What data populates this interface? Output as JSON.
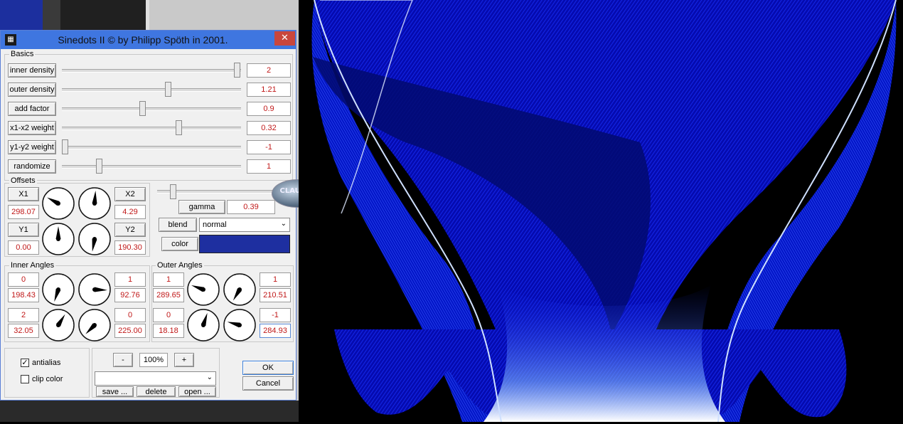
{
  "window": {
    "title": "Sinedots II © by Philipp Spöth in 2001.",
    "icon": "app-pattern-icon",
    "close_label": "✕"
  },
  "basics": {
    "label": "Basics",
    "rows": [
      {
        "label": "inner density",
        "value": "2",
        "slider": 1.0
      },
      {
        "label": "outer density",
        "value": "1.21",
        "slider": 0.6
      },
      {
        "label": "add factor",
        "value": "0.9",
        "slider": 0.45
      },
      {
        "label": "x1-x2 weight",
        "value": "0.32",
        "slider": 0.66
      },
      {
        "label": "y1-y2 weight",
        "value": "-1",
        "slider": 0.0
      },
      {
        "label": "randomize",
        "value": "1",
        "slider": 0.2
      }
    ]
  },
  "offsets": {
    "label": "Offsets",
    "x1": {
      "label": "X1",
      "value": "298.07"
    },
    "x2": {
      "label": "X2",
      "value": "4.29"
    },
    "y1": {
      "label": "Y1",
      "value": "0.00"
    },
    "y2": {
      "label": "Y2",
      "value": "190.30"
    }
  },
  "gamma": {
    "label": "gamma",
    "value": "0.39",
    "slider": 0.1
  },
  "blend": {
    "label": "blend",
    "value": "normal"
  },
  "color": {
    "label": "color",
    "swatch": "#1e2fa0"
  },
  "inner_angles": {
    "label": "Inner Angles",
    "a": {
      "top": "0",
      "value": "198.43"
    },
    "b": {
      "top": "1",
      "value": "92.76"
    },
    "c": {
      "top": "2",
      "value": "32.05"
    },
    "d": {
      "top": "0",
      "value": "225.00"
    }
  },
  "outer_angles": {
    "label": "Outer Angles",
    "a": {
      "top": "1",
      "value": "289.65"
    },
    "b": {
      "top": "1",
      "value": "210.51"
    },
    "c": {
      "top": "0",
      "value": "18.18"
    },
    "d": {
      "top": "-1",
      "value": "284.93"
    }
  },
  "options": {
    "antialias": {
      "label": "antialias",
      "checked": true
    },
    "clip_color": {
      "label": "clip color",
      "checked": false
    }
  },
  "zoom": {
    "minus": "-",
    "value": "100%",
    "plus": "+"
  },
  "presets": {
    "save": "save ...",
    "delete": "delete",
    "open": "open ..."
  },
  "actions": {
    "ok": "OK",
    "cancel": "Cancel"
  },
  "watermark": {
    "text": "CLAUDIA"
  },
  "preview": {
    "bg": "#000000",
    "line": "#0a1cff",
    "highlight": "#e8f0ff"
  }
}
